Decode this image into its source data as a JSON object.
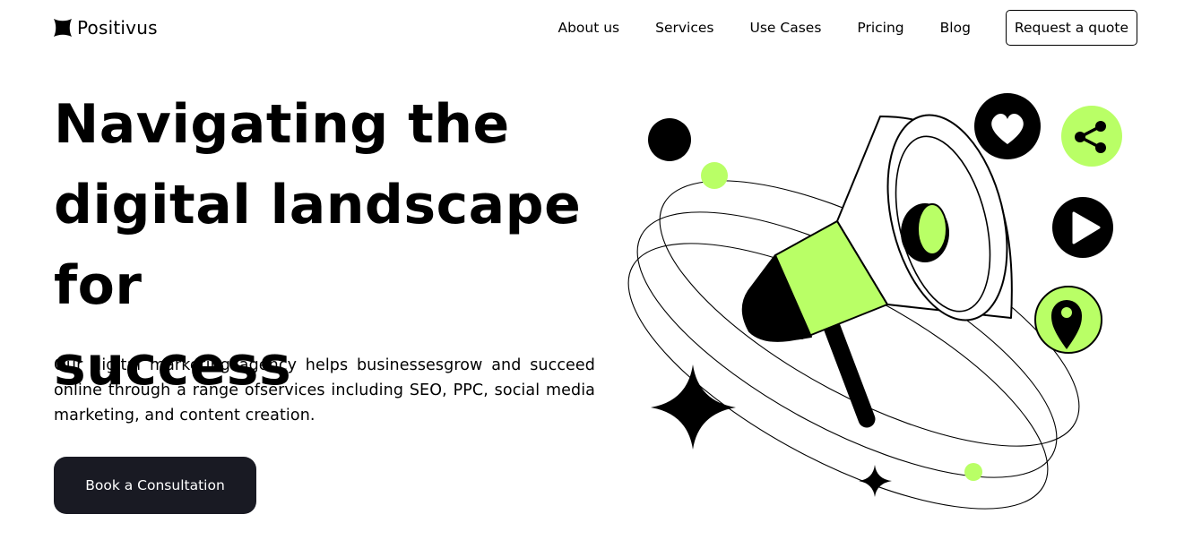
{
  "brand": {
    "name": "Positivus",
    "logo_icon": "sparkle-logo-icon"
  },
  "nav": {
    "links": [
      "About us",
      "Services",
      "Use Cases",
      "Pricing",
      "Blog"
    ],
    "cta_label": "Request a quote"
  },
  "hero": {
    "title_lines": [
      "Navigating the",
      "digital landscape for",
      "success"
    ],
    "description": "Our digital marketing agency helps businessesgrow and succeed online through a range ofservices including SEO, PPC, social media marketing, and content creation.",
    "cta_label": "Book a Consultation"
  },
  "illustration": {
    "icons": [
      "megaphone-icon",
      "heart-icon",
      "share-icon",
      "play-icon",
      "location-pin-icon",
      "sparkle-star-icon"
    ]
  },
  "colors": {
    "accent": "#B9FF66",
    "dark": "#191A23",
    "text": "#000000",
    "background": "#FFFFFF"
  }
}
